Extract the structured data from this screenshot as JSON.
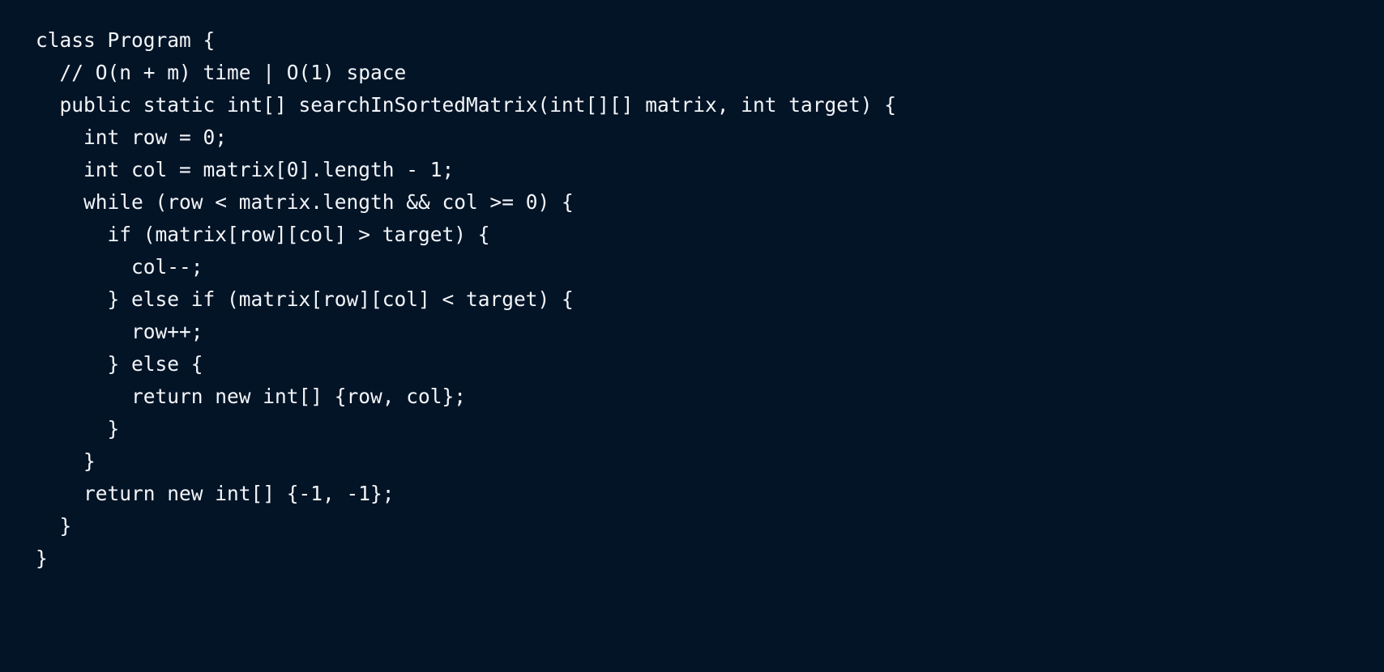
{
  "code": {
    "lines": [
      "class Program {",
      "  // O(n + m) time | O(1) space",
      "  public static int[] searchInSortedMatrix(int[][] matrix, int target) {",
      "    int row = 0;",
      "    int col = matrix[0].length - 1;",
      "    while (row < matrix.length && col >= 0) {",
      "      if (matrix[row][col] > target) {",
      "        col--;",
      "      } else if (matrix[row][col] < target) {",
      "        row++;",
      "      } else {",
      "        return new int[] {row, col};",
      "      }",
      "    }",
      "    return new int[] {-1, -1};",
      "  }",
      "}"
    ]
  },
  "colors": {
    "background": "#041427",
    "text": "#f2f5f8"
  }
}
